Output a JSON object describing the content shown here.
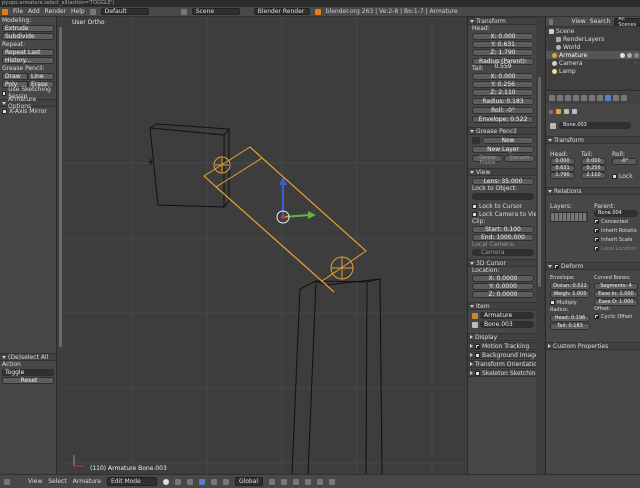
{
  "title_bar": "py.ops.armature.select_all(action='TOGGLE')",
  "top_menu": {
    "items": [
      "File",
      "Add",
      "Render",
      "Help"
    ],
    "layout": "Default",
    "scene": "Scene",
    "engine": "Blender Render",
    "stats": "blender.org 263 | Ve:2-8 | Bo:1-7 | Armature"
  },
  "tool_panel": {
    "modeling_label": "Modeling:",
    "extrude": "Extrude",
    "subdivide": "Subdivide",
    "repeat_label": "Repeat:",
    "repeat_last": "Repeat Last",
    "history": "History...",
    "grease_label": "Grease Pencil:",
    "draw": "Draw",
    "line": "Line",
    "poly": "Poly",
    "erase": "Erase",
    "use_sketching": "Use Sketching Sessio",
    "armature_options": "Armature Options",
    "xaxis_mirror": "X-Axis Mirror",
    "operator_title": "(De)select All",
    "action_label": "Action",
    "action_value": "Toggle",
    "reset": "Reset"
  },
  "viewport": {
    "title": "User Ortho",
    "status": "(110) Armature Bone.003"
  },
  "n_panel": {
    "transform": "Transform",
    "head_label": "Head:",
    "head": [
      "X: 0.000",
      "Y: 0.631",
      "Z: 1.790"
    ],
    "radius_parent": "Radius (Parent): 0.559",
    "tail_label": "Tail:",
    "tail": [
      "X: 0.000",
      "Y: 0.256",
      "Z: 2.110"
    ],
    "radius": "Radius: 0.183",
    "roll": "Roll: -0°",
    "envelope": "Envelope: 0.522",
    "grease_pencil": "Grease Pencil",
    "new": "New",
    "new_layer": "New Layer",
    "delete_frame": "Delete Frame",
    "convert": "Convert",
    "view": "View",
    "lens": "Lens: 35.000",
    "lock_to_object": "Lock to Object:",
    "lock_cursor": "Lock to Cursor",
    "lock_camera": "Lock Camera to View",
    "clip": "Clip:",
    "clip_start": "Start: 0.100",
    "clip_end": "End: 1000.000",
    "local_camera": "Local Camera:",
    "camera": "Camera",
    "cursor_3d": "3D Cursor",
    "location_label": "Location:",
    "location": [
      "X: 0.0000",
      "Y: 0.0000",
      "Z: 0.0000"
    ],
    "item": "Item",
    "item_object": "Armature",
    "item_bone": "Bone.003",
    "display": "Display",
    "motion_tracking": "Motion Tracking",
    "background_images": "Background Images",
    "transform_orientations": "Transform Orientations",
    "skeleton_sketching": "Skeleton Sketching"
  },
  "outliner": {
    "menus": [
      "View",
      "Search"
    ],
    "filter": "All Scenes",
    "items": [
      "Scene",
      "RenderLayers",
      "World",
      "Armature",
      "Camera",
      "Lamp"
    ]
  },
  "properties": {
    "bone_name": "Bone.003",
    "transform": "Transform",
    "head_label": "Head:",
    "tail_label": "Tail:",
    "roll_label": "Roll:",
    "head": [
      "0.000",
      "0.631",
      "1.790"
    ],
    "tail": [
      "0.000",
      "0.256",
      "2.110"
    ],
    "roll": "-0°",
    "lock": "Lock",
    "relations": "Relations",
    "layers_label": "Layers:",
    "parent_label": "Parent:",
    "parent": "Bone.004",
    "connected": "Connected",
    "inherit_rotation": "Inherit Rotatio",
    "inherit_scale": "Inherit Scale",
    "local_location": "Local Location",
    "deform": "Deform",
    "envelope_label": "Envelope:",
    "curved_label": "Curved Bones:",
    "distance": "Distan: 0.522",
    "weight": "Weigh: 1.000",
    "segments": "Segments: 4",
    "ease_in": "Ease In: 1.000",
    "ease_out": "Ease O: 1.000",
    "multiply": "Multiply",
    "radius_label": "Radius:",
    "offset_label": "Offset:",
    "rad_head": "Head: 0.196",
    "rad_tail": "Tail: 0.183",
    "cyclic_offset": "Cyclic Offset",
    "custom_properties": "Custom Properties"
  },
  "bottom_bar": {
    "items": [
      "View",
      "Select",
      "Armature"
    ],
    "mode": "Edit Mode",
    "orientation": "Global"
  },
  "colors": {
    "bone_selected": "#e8a030",
    "bone_wire": "#111111",
    "grid": "#474747",
    "axis_x": "#c0392b",
    "axis_y": "#5fb34e",
    "axis_z": "#3a5fd0"
  }
}
